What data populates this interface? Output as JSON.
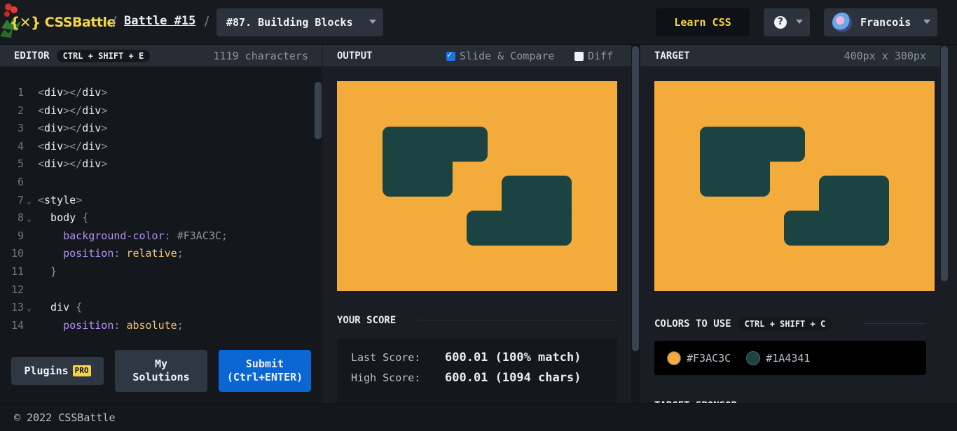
{
  "header": {
    "logo_text": "CSSBattle",
    "logo_mark": "{✕}",
    "separator": "/",
    "battle_link": "Battle #15",
    "target_select": "#87. Building Blocks",
    "learn_button": "Learn CSS",
    "help_icon": "?",
    "user_name": "Francois"
  },
  "editor": {
    "title": "EDITOR",
    "shortcut": "CTRL + SHIFT + E",
    "char_count": "1119 characters",
    "lines": [
      {
        "n": "1",
        "parts": [
          [
            "tag",
            "<div>"
          ],
          [
            "tag",
            "</div>"
          ]
        ]
      },
      {
        "n": "2",
        "parts": [
          [
            "tag",
            "<div>"
          ],
          [
            "tag",
            "</div>"
          ]
        ]
      },
      {
        "n": "3",
        "parts": [
          [
            "tag",
            "<div>"
          ],
          [
            "tag",
            "</div>"
          ]
        ]
      },
      {
        "n": "4",
        "parts": [
          [
            "tag",
            "<div>"
          ],
          [
            "tag",
            "</div>"
          ]
        ]
      },
      {
        "n": "5",
        "parts": [
          [
            "tag",
            "<div>"
          ],
          [
            "tag",
            "</div>"
          ]
        ]
      },
      {
        "n": "6",
        "parts": []
      },
      {
        "n": "7",
        "fold": true,
        "parts": [
          [
            "tag",
            "<style>"
          ]
        ]
      },
      {
        "n": "8",
        "fold": true,
        "parts": [
          [
            "sel",
            "  body "
          ],
          [
            "punc",
            "{"
          ]
        ]
      },
      {
        "n": "9",
        "parts": [
          [
            "sel",
            "    "
          ],
          [
            "prop",
            "background-color"
          ],
          [
            "punc",
            ": "
          ],
          [
            "valc",
            "#F3AC3C"
          ],
          [
            "punc",
            ";"
          ]
        ]
      },
      {
        "n": "10",
        "parts": [
          [
            "sel",
            "    "
          ],
          [
            "prop",
            "position"
          ],
          [
            "punc",
            ": "
          ],
          [
            "val",
            "relative"
          ],
          [
            "punc",
            ";"
          ]
        ]
      },
      {
        "n": "11",
        "parts": [
          [
            "punc",
            "  }"
          ]
        ]
      },
      {
        "n": "12",
        "parts": []
      },
      {
        "n": "13",
        "fold": true,
        "parts": [
          [
            "sel",
            "  div "
          ],
          [
            "punc",
            "{"
          ]
        ]
      },
      {
        "n": "14",
        "parts": [
          [
            "sel",
            "    "
          ],
          [
            "prop",
            "position"
          ],
          [
            "punc",
            ": "
          ],
          [
            "val",
            "absolute"
          ],
          [
            "punc",
            ";"
          ]
        ]
      }
    ],
    "plugins_button": "Plugins",
    "pro_badge": "PRO",
    "solutions_button_l1": "My",
    "solutions_button_l2": "Solutions",
    "submit_button_l1": "Submit",
    "submit_button_l2": "(Ctrl+ENTER)"
  },
  "output": {
    "title": "OUTPUT",
    "slide_compare": "Slide & Compare",
    "slide_compare_checked": true,
    "diff": "Diff",
    "diff_checked": false,
    "score_title": "YOUR SCORE",
    "last_score_label": "Last Score:",
    "last_score_value": "600.01 (100% match)",
    "high_score_label": "High Score:",
    "high_score_value": "600.01 (1094 chars)"
  },
  "target": {
    "title": "TARGET",
    "size": "400px x 300px",
    "colors_title": "COLORS TO USE",
    "colors_shortcut": "CTRL + SHIFT + C",
    "colors": [
      {
        "hex": "#F3AC3C"
      },
      {
        "hex": "#1A4341"
      }
    ],
    "sponsor_title": "TARGET SPONSOR"
  },
  "footer": {
    "copyright": "© 2022 CSSBattle"
  },
  "theme": {
    "accent_yellow": "#f5d442",
    "submit_blue": "#0a66d3",
    "canvas_bg": "#f3ac3c",
    "block_color": "#1a4341"
  }
}
